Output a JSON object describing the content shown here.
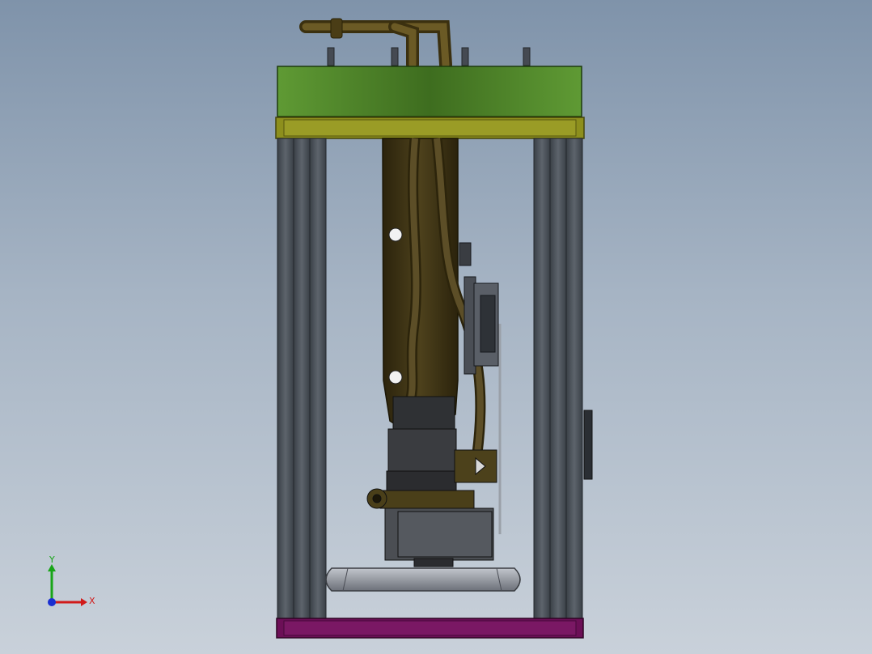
{
  "view": {
    "background_top": "#7f93aa",
    "background_bottom": "#c9d1da"
  },
  "colors": {
    "top_plate": "#4f8a2a",
    "yellow_frame": "#8d8f1d",
    "base_plate": "#6c0f57",
    "column": "#4c535b",
    "robot_body": "#3f3415",
    "hose": "#5c4e27",
    "gripper": "#8e9199"
  },
  "triad": {
    "x_label": "X",
    "y_label": "Y",
    "x_color": "#d11a1a",
    "y_color": "#18a518",
    "z_color": "#1a2fd1"
  }
}
